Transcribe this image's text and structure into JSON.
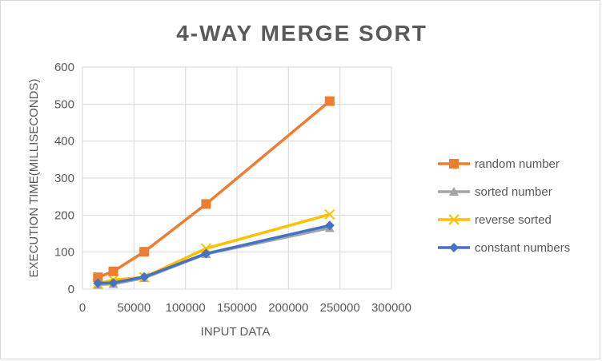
{
  "chart_data": {
    "type": "line",
    "title": "4-WAY MERGE SORT",
    "xlabel": "INPUT DATA",
    "ylabel": "EXECUTION TIME(MILLISECONDS)",
    "xlim": [
      0,
      300000
    ],
    "ylim": [
      0,
      600
    ],
    "x_ticks": [
      0,
      50000,
      100000,
      150000,
      200000,
      250000,
      300000
    ],
    "y_ticks": [
      0,
      100,
      200,
      300,
      400,
      500,
      600
    ],
    "grid": true,
    "legend_position": "right",
    "series": [
      {
        "name": "random number",
        "color": "#ED7D31",
        "marker": "square",
        "points": [
          [
            15000,
            32
          ],
          [
            30000,
            48
          ],
          [
            60000,
            101
          ],
          [
            120000,
            230
          ],
          [
            240000,
            508
          ]
        ]
      },
      {
        "name": "sorted number",
        "color": "#A5A5A5",
        "marker": "triangle",
        "points": [
          [
            15000,
            12
          ],
          [
            30000,
            14
          ],
          [
            60000,
            30
          ],
          [
            120000,
            95
          ],
          [
            240000,
            165
          ]
        ]
      },
      {
        "name": "reverse sorted",
        "color": "#FFC000",
        "marker": "x",
        "points": [
          [
            15000,
            15
          ],
          [
            30000,
            25
          ],
          [
            60000,
            32
          ],
          [
            120000,
            110
          ],
          [
            240000,
            202
          ]
        ]
      },
      {
        "name": "constant numbers",
        "color": "#4472C4",
        "marker": "diamond",
        "points": [
          [
            15000,
            16
          ],
          [
            30000,
            17
          ],
          [
            60000,
            33
          ],
          [
            120000,
            96
          ],
          [
            240000,
            172
          ]
        ]
      }
    ]
  }
}
